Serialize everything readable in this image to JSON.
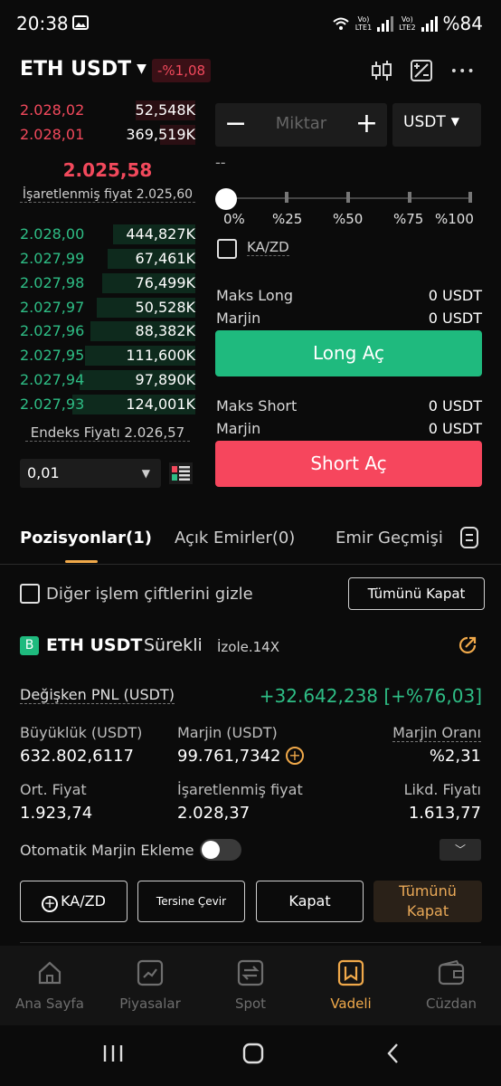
{
  "status_bar": {
    "time": "20:38",
    "battery": "%84",
    "lte1": "LTE1",
    "lte2": "LTE2",
    "vo1": "Vo)",
    "vo2": "Vo)"
  },
  "header": {
    "pair": "ETH USDT",
    "change": "-%1,08"
  },
  "orderbook": {
    "asks": [
      {
        "price": "2.028,02",
        "qty": "52,548K",
        "depth": 0.34
      },
      {
        "price": "2.028,01",
        "qty": "369,519K",
        "depth": 0.2
      }
    ],
    "last_price": "2.025,58",
    "mark_price_label": "İşaretlenmiş fiyat 2.025,60",
    "bids": [
      {
        "price": "2.028,00",
        "qty": "444,827K",
        "depth": 0.47
      },
      {
        "price": "2.027,99",
        "qty": "67,461K",
        "depth": 0.5
      },
      {
        "price": "2.027,98",
        "qty": "76,499K",
        "depth": 0.53
      },
      {
        "price": "2.027,97",
        "qty": "50,528K",
        "depth": 0.56
      },
      {
        "price": "2.027,96",
        "qty": "88,382K",
        "depth": 0.6
      },
      {
        "price": "2.027,95",
        "qty": "111,600K",
        "depth": 0.63
      },
      {
        "price": "2.027,94",
        "qty": "97,890K",
        "depth": 0.66
      },
      {
        "price": "2.027,93",
        "qty": "124,001K",
        "depth": 0.7
      }
    ],
    "index_price_label": "Endeks Fiyatı 2.026,57",
    "tick_size": "0,01"
  },
  "order_form": {
    "minus": "−",
    "plus": "+",
    "amount_placeholder": "Miktar",
    "unit": "USDT",
    "dash": "--",
    "percent_marks": [
      "0%",
      "%25",
      "%50",
      "%75",
      "%100"
    ],
    "tpsl_label": "KA/ZD",
    "max_long_label": "Maks Long",
    "max_long_value": "0 USDT",
    "margin_label": "Marjin",
    "long_margin_value": "0 USDT",
    "long_button": "Long Aç",
    "max_short_label": "Maks Short",
    "max_short_value": "0 USDT",
    "short_margin_value": "0 USDT",
    "short_button": "Short Aç"
  },
  "tabs": [
    {
      "label": "Pozisyonlar(1)"
    },
    {
      "label": "Açık Emirler(0)"
    },
    {
      "label": "Emir Geçmişi"
    }
  ],
  "filter": {
    "hide_label": "Diğer işlem çiftlerini gizle",
    "close_all": "Tümünü Kapat"
  },
  "position": {
    "badge": "B",
    "pair": "ETH USDT",
    "type": "Sürekli",
    "mode": "İzole.14X",
    "pnl_label": "Değişken PNL (USDT)",
    "pnl_value": "+32.642,238 [+%76,03]",
    "size_label": "Büyüklük (USDT)",
    "size_value": "632.802,6117",
    "margin_label": "Marjin (USDT)",
    "margin_value": "99.761,7342",
    "margin_ratio_label": "Marjin Oranı",
    "margin_ratio_value": "%2,31",
    "entry_label": "Ort. Fiyat",
    "entry_value": "1.923,74",
    "mark_label": "İşaretlenmiş fiyat",
    "mark_value": "2.028,37",
    "liq_label": "Likd. Fiyatı",
    "liq_value": "1.613,77",
    "auto_margin_label": "Otomatik Marjin Ekleme",
    "btn_tpsl": "KA/ZD",
    "btn_reverse": "Tersine Çevir",
    "btn_close": "Kapat",
    "btn_close_all_1": "Tümünü",
    "btn_close_all_2": "Kapat"
  },
  "bottom_nav": [
    {
      "label": "Ana Sayfa",
      "icon": "home-icon"
    },
    {
      "label": "Piyasalar",
      "icon": "markets-icon"
    },
    {
      "label": "Spot",
      "icon": "spot-icon"
    },
    {
      "label": "Vadeli",
      "icon": "futures-icon",
      "active": true
    },
    {
      "label": "Cüzdan",
      "icon": "wallet-icon"
    }
  ],
  "colors": {
    "red": "#f2495c",
    "green": "#2ebd85",
    "accent": "#f0a94a",
    "bg": "#0b0b0b"
  }
}
